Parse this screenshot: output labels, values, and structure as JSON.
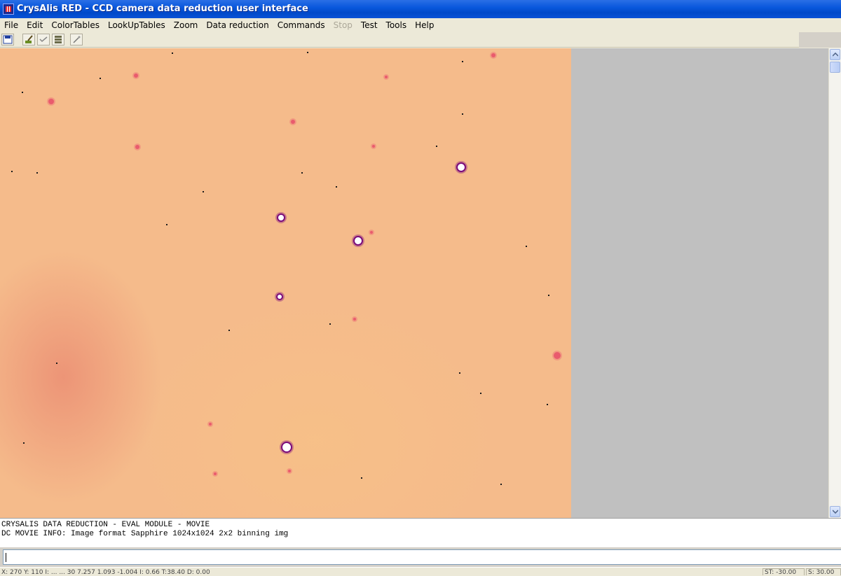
{
  "window": {
    "title": "CrysAlis RED - CCD camera data reduction user interface"
  },
  "menu": [
    {
      "label": "File",
      "enabled": true
    },
    {
      "label": "Edit",
      "enabled": true
    },
    {
      "label": "ColorTables",
      "enabled": true
    },
    {
      "label": "LookUpTables",
      "enabled": true
    },
    {
      "label": "Zoom",
      "enabled": true
    },
    {
      "label": "Data reduction",
      "enabled": true
    },
    {
      "label": "Commands",
      "enabled": true
    },
    {
      "label": "Stop",
      "enabled": false
    },
    {
      "label": "Test",
      "enabled": true
    },
    {
      "label": "Tools",
      "enabled": true
    },
    {
      "label": "Help",
      "enabled": true
    }
  ],
  "toolbar": {
    "buttons": [
      "save-icon",
      "brush-icon",
      "check-icon",
      "layers-icon",
      "wand-icon"
    ]
  },
  "image": {
    "colors": {
      "background": "#f5bb8b",
      "spot_halo": "#7a0a7a",
      "spot_core": "#ffffff",
      "weak_spot": "#e8506a",
      "dust": "#1a1a1a"
    }
  },
  "console": {
    "line1": "CRYSALIS DATA REDUCTION - EVAL MODULE - MOVIE",
    "line2": "DC MOVIE INFO: Image format Sapphire 1024x1024 2x2 binning img"
  },
  "command": {
    "value": ""
  },
  "status": {
    "left": "X: 270 Y: 110 I: ... ... 30 7.257 1.093 -1.004 I: 0.66 T:38.40 D: 0.00",
    "right_a": "ST: -30.00",
    "right_b": "S: 30.00"
  }
}
